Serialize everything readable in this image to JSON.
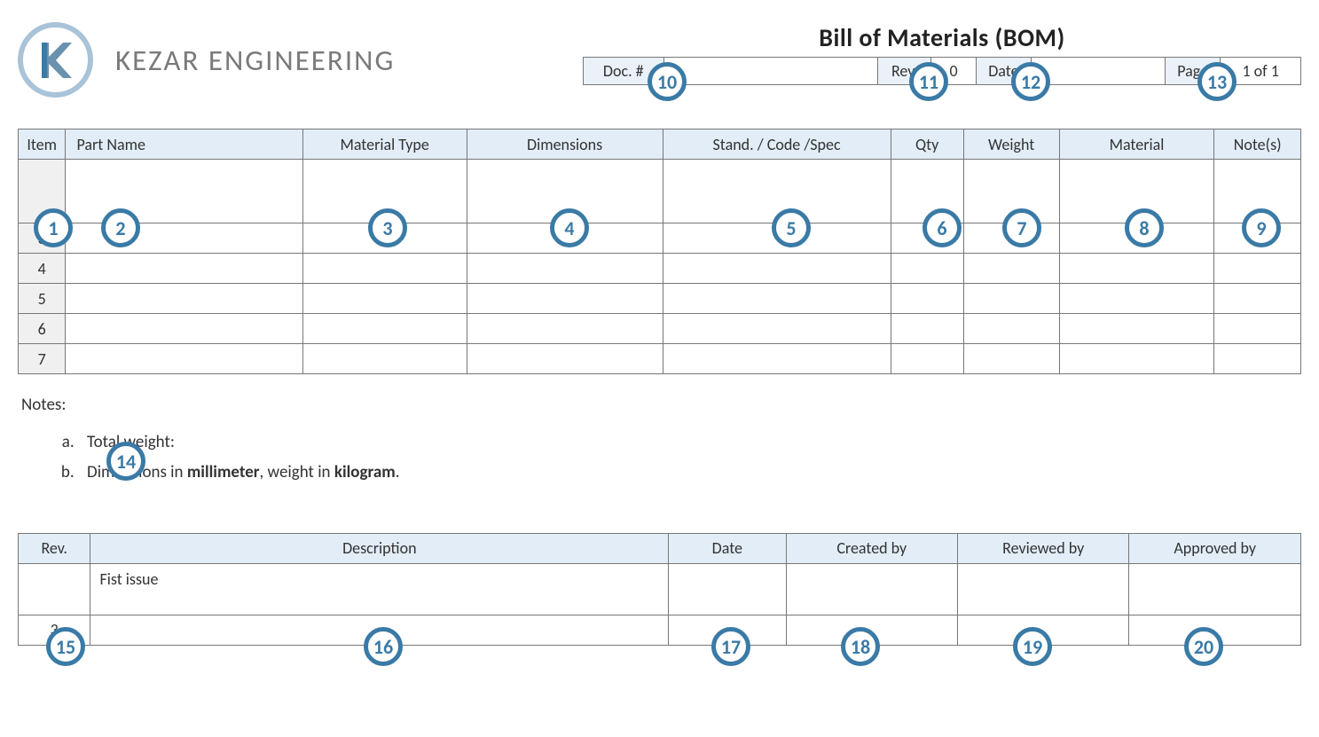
{
  "company": "KEZAR ENGINEERING",
  "docTitle": "Bill of Materials (BOM)",
  "meta": {
    "docLabel": "Doc.  #",
    "docValue": "",
    "revLabel": "Rev.",
    "revValue": "0",
    "dateLabel": "Date",
    "dateValue": "",
    "pageLabel": "Page",
    "pageValue": "1 of 1"
  },
  "bom": {
    "headers": [
      "Item",
      "Part Name",
      "Material Type",
      "Dimensions",
      "Stand. / Code /Spec",
      "Qty",
      "Weight",
      "Material",
      "Note(s)"
    ],
    "rows": [
      {
        "item": "",
        "part": "",
        "mat": "",
        "dim": "",
        "spec": "",
        "qty": "",
        "wt": "",
        "material": "",
        "notes": ""
      },
      {
        "item": "3",
        "part": "",
        "mat": "",
        "dim": "",
        "spec": "",
        "qty": "",
        "wt": "",
        "material": "",
        "notes": ""
      },
      {
        "item": "4",
        "part": "",
        "mat": "",
        "dim": "",
        "spec": "",
        "qty": "",
        "wt": "",
        "material": "",
        "notes": ""
      },
      {
        "item": "5",
        "part": "",
        "mat": "",
        "dim": "",
        "spec": "",
        "qty": "",
        "wt": "",
        "material": "",
        "notes": ""
      },
      {
        "item": "6",
        "part": "",
        "mat": "",
        "dim": "",
        "spec": "",
        "qty": "",
        "wt": "",
        "material": "",
        "notes": ""
      },
      {
        "item": "7",
        "part": "",
        "mat": "",
        "dim": "",
        "spec": "",
        "qty": "",
        "wt": "",
        "material": "",
        "notes": ""
      }
    ]
  },
  "notes": {
    "label": "Notes:",
    "a_pre": "Total weight:",
    "b_pre": "Dimensions in ",
    "b_bold1": "millimeter",
    "b_mid": ", weight in ",
    "b_bold2": "kilogram",
    "b_post": "."
  },
  "rev": {
    "headers": [
      "Rev.",
      "Description",
      "Date",
      "Created by",
      "Reviewed by",
      "Approved by"
    ],
    "rows": [
      {
        "rev": "",
        "desc": "Fist issue",
        "date": "",
        "cr": "",
        "rv": "",
        "ap": ""
      },
      {
        "rev": "3",
        "desc": "",
        "date": "",
        "cr": "",
        "rv": "",
        "ap": ""
      }
    ]
  },
  "callouts": {
    "c1": "1",
    "c2": "2",
    "c3": "3",
    "c4": "4",
    "c5": "5",
    "c6": "6",
    "c7": "7",
    "c8": "8",
    "c9": "9",
    "c10": "10",
    "c11": "11",
    "c12": "12",
    "c13": "13",
    "c14": "14",
    "c15": "15",
    "c16": "16",
    "c17": "17",
    "c18": "18",
    "c19": "19",
    "c20": "20"
  }
}
